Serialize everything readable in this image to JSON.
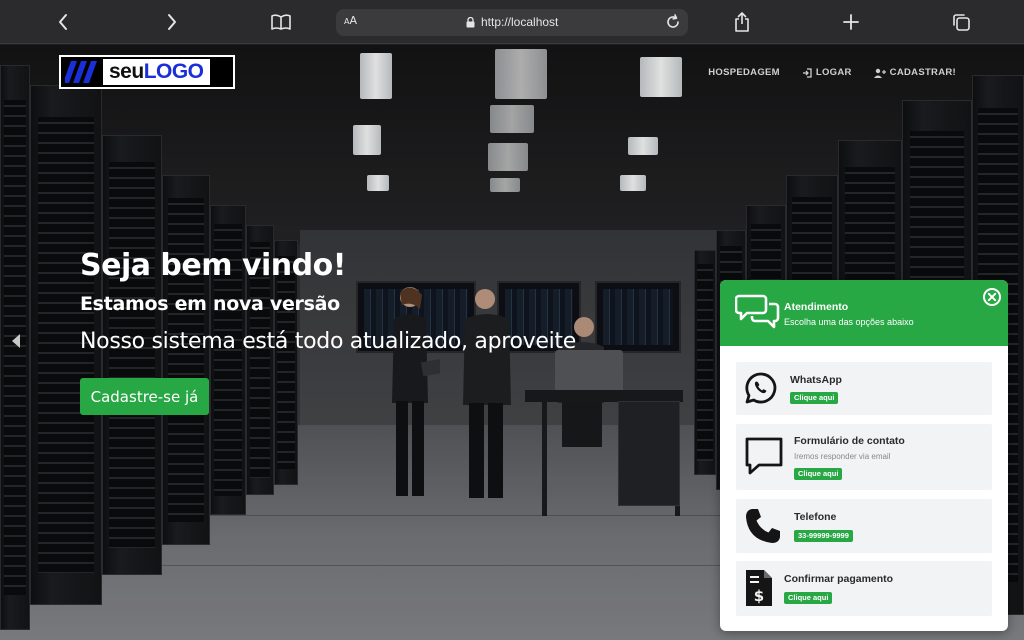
{
  "browser": {
    "aa_label": "AA",
    "url": "http://localhost"
  },
  "nav": {
    "logo": {
      "part1": "seu",
      "part2": "LOGO"
    },
    "items": [
      {
        "label": "HOSPEDAGEM"
      },
      {
        "label": "LOGAR"
      },
      {
        "label": "CADASTRAR!"
      }
    ]
  },
  "hero": {
    "title": "Seja bem vindo!",
    "subtitle": "Estamos em nova versão",
    "description": "Nosso sistema está todo atualizado, aproveite",
    "cta_label": "Cadastre-se já"
  },
  "widget": {
    "title": "Atendimento",
    "subtitle": "Escolha uma das opções abaixo",
    "options": [
      {
        "title": "WhatsApp",
        "description": "",
        "badge": "Clique aqui",
        "icon": "whatsapp-icon"
      },
      {
        "title": "Formulário de contato",
        "description": "Iremos responder via email",
        "badge": "Clique aqui",
        "icon": "chat-bubble-icon"
      },
      {
        "title": "Telefone",
        "description": "",
        "badge": "33-99999-9999",
        "icon": "phone-icon"
      },
      {
        "title": "Confirmar pagamento",
        "description": "",
        "badge": "Clique aqui",
        "icon": "invoice-dollar-icon"
      }
    ]
  },
  "colors": {
    "accent_green": "#28a745",
    "logo_blue": "#1a2fd8",
    "browser_bar": "#2b2b2d"
  }
}
